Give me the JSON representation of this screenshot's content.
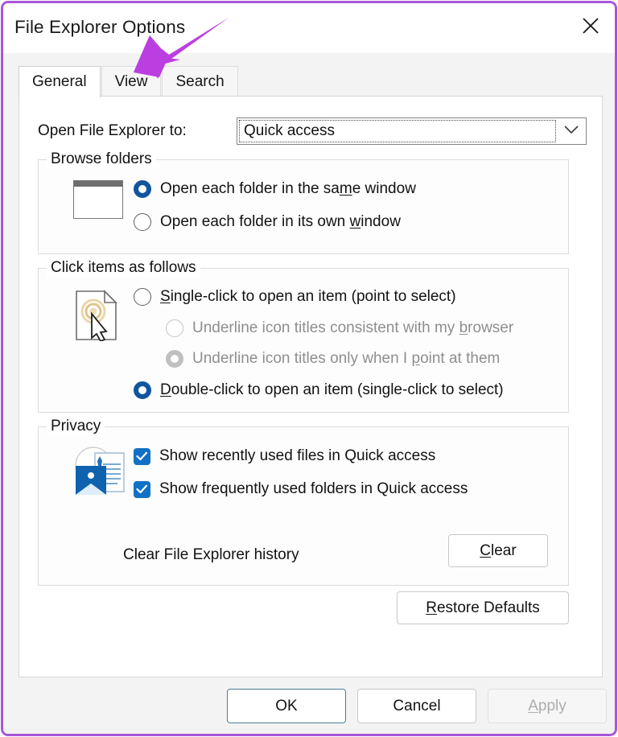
{
  "window": {
    "title": "File Explorer Options",
    "close_icon": "close-icon",
    "border_color": "#a855d8"
  },
  "tabs": [
    {
      "label": "General",
      "selected": true
    },
    {
      "label": "View",
      "selected": false
    },
    {
      "label": "Search",
      "selected": false
    }
  ],
  "annotation": {
    "arrow_color": "#bb3fe0",
    "points_to": "View"
  },
  "open_to": {
    "label": "Open File Explorer to:",
    "value": "Quick access",
    "chevron_icon": "chevron-down-icon"
  },
  "browse_folders": {
    "legend": "Browse folders",
    "icon": "window-icon",
    "options": [
      {
        "label_pre": "Open each folder in the sa",
        "accel": "m",
        "label_post": "e window",
        "selected": true
      },
      {
        "label_pre": "Open each folder in its own ",
        "accel": "w",
        "label_post": "indow",
        "selected": false
      }
    ]
  },
  "click_items": {
    "legend": "Click items as follows",
    "icon": "document-cursor-icon",
    "options": [
      {
        "accel": "S",
        "label_pre": "",
        "label_post": "ingle-click to open an item (point to select)",
        "selected": false,
        "disabled": false,
        "indent": false
      },
      {
        "accel": "b",
        "label_pre": "Underline icon titles consistent with my ",
        "label_post": "rowser",
        "selected": false,
        "disabled": true,
        "indent": true
      },
      {
        "accel": "p",
        "label_pre": "Underline icon titles only when I ",
        "label_post": "oint at them",
        "selected": true,
        "disabled": true,
        "indent": true
      },
      {
        "accel": "D",
        "label_pre": "",
        "label_post": "ouble-click to open an item (single-click to select)",
        "selected": true,
        "disabled": false,
        "indent": false
      }
    ]
  },
  "privacy": {
    "legend": "Privacy",
    "icon": "privacy-shield-document-icon",
    "checkboxes": [
      {
        "label": "Show recently used files in Quick access",
        "checked": true
      },
      {
        "label": "Show frequently used folders in Quick access",
        "checked": true
      }
    ],
    "clear_label": "Clear File Explorer history",
    "clear_button": {
      "accel": "C",
      "label_post": "lear"
    }
  },
  "restore_defaults": {
    "accel": "R",
    "label_post": "estore Defaults"
  },
  "footer": {
    "ok": "OK",
    "cancel": "Cancel",
    "apply": {
      "accel": "A",
      "label_post": "pply",
      "enabled": false
    }
  },
  "colors": {
    "accent_blue": "#1271c4",
    "radio_selected": "#10559e",
    "disabled_text": "#8e8e8e",
    "annotation_purple": "#bb3fe0"
  }
}
